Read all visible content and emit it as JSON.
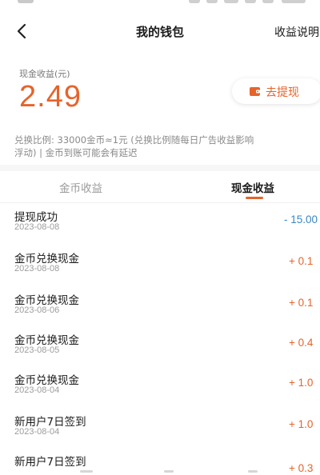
{
  "header": {
    "title": "我的钱包",
    "help_label": "收益说明"
  },
  "balance": {
    "label": "现金收益(元)",
    "value": "2.49",
    "withdraw_label": "去提现"
  },
  "note": {
    "line1": "兑换比例: 33000金币≈1元 (兑换比例随每日广告收益影响",
    "line2": "浮动) | 金币到账可能会有延迟"
  },
  "tabs": [
    {
      "label": "金币收益",
      "active": false
    },
    {
      "label": "现金收益",
      "active": true
    }
  ],
  "records": [
    {
      "title": "提现成功",
      "date": "2023-08-08",
      "amount": "- 15.00",
      "type": "neg"
    },
    {
      "title": "金币兑换现金",
      "date": "2023-08-08",
      "amount": "+ 0.1",
      "type": "pos"
    },
    {
      "title": "金币兑换现金",
      "date": "2023-08-06",
      "amount": "+ 0.1",
      "type": "pos"
    },
    {
      "title": "金币兑换现金",
      "date": "2023-08-05",
      "amount": "+ 0.4",
      "type": "pos"
    },
    {
      "title": "金币兑换现金",
      "date": "2023-08-04",
      "amount": "+ 1.0",
      "type": "pos"
    },
    {
      "title": "新用户7日签到",
      "date": "2023-08-04",
      "amount": "+ 1.0",
      "type": "pos"
    },
    {
      "title": "新用户7日签到",
      "date": "",
      "amount": "+ 0.3",
      "type": "pos"
    }
  ],
  "colors": {
    "accent": "#e5642b",
    "negative": "#3b86c4"
  },
  "icons": {
    "back": "back-arrow-icon",
    "wallet": "wallet-icon"
  }
}
